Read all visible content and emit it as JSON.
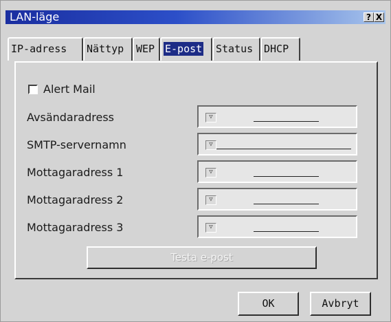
{
  "window": {
    "title": "LAN-läge",
    "help_label": "?",
    "close_label": "X"
  },
  "tabs": [
    {
      "label": "IP-adress",
      "active": false
    },
    {
      "label": "Nättyp",
      "active": false
    },
    {
      "label": "WEP",
      "active": false
    },
    {
      "label": "E-post",
      "active": true
    },
    {
      "label": "Status",
      "active": false
    },
    {
      "label": "DHCP",
      "active": false
    }
  ],
  "email": {
    "alert_mail": {
      "label": "Alert Mail",
      "checked": false
    },
    "fields": [
      {
        "label": "Avsändaradress",
        "value": ""
      },
      {
        "label": "SMTP-servernamn",
        "value": ""
      },
      {
        "label": "Mottagaradress 1",
        "value": ""
      },
      {
        "label": "Mottagaradress 2",
        "value": ""
      },
      {
        "label": "Mottagaradress 3",
        "value": ""
      }
    ],
    "dropdown_icon": "dropdown-arrow-icon",
    "test_button": "Testa e-post"
  },
  "footer": {
    "ok": "OK",
    "cancel": "Avbryt"
  }
}
